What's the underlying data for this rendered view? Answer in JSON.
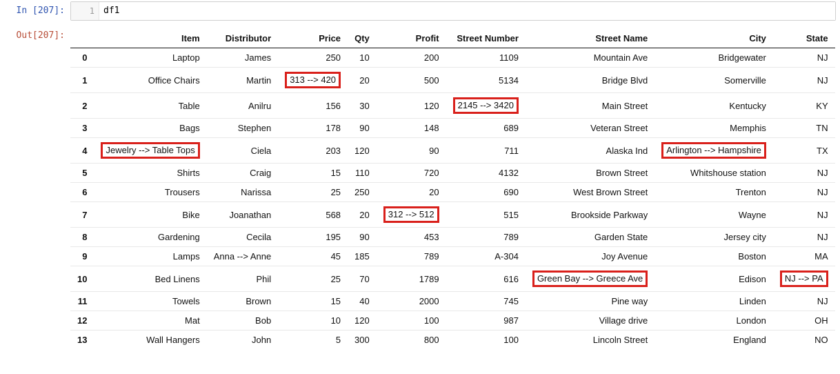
{
  "input": {
    "prompt": "In [207]:",
    "line_number": "1",
    "code": "df1"
  },
  "output": {
    "prompt": "Out[207]:",
    "columns": [
      "Item",
      "Distributor",
      "Price",
      "Qty",
      "Profit",
      "Street Number",
      "Street Name",
      "City",
      "State"
    ],
    "rows": [
      {
        "idx": "0",
        "cells": [
          {
            "v": "Laptop"
          },
          {
            "v": "James"
          },
          {
            "v": "250"
          },
          {
            "v": "10"
          },
          {
            "v": "200"
          },
          {
            "v": "1109"
          },
          {
            "v": "Mountain Ave"
          },
          {
            "v": "Bridgewater"
          },
          {
            "v": "NJ"
          }
        ]
      },
      {
        "idx": "1",
        "cells": [
          {
            "v": "Office Chairs"
          },
          {
            "v": "Martin"
          },
          {
            "v": "313 --> 420",
            "hl": true
          },
          {
            "v": "20"
          },
          {
            "v": "500"
          },
          {
            "v": "5134"
          },
          {
            "v": "Bridge Blvd"
          },
          {
            "v": "Somerville"
          },
          {
            "v": "NJ"
          }
        ]
      },
      {
        "idx": "2",
        "cells": [
          {
            "v": "Table"
          },
          {
            "v": "Anilru"
          },
          {
            "v": "156"
          },
          {
            "v": "30"
          },
          {
            "v": "120"
          },
          {
            "v": "2145 --> 3420",
            "hl": true
          },
          {
            "v": "Main Street"
          },
          {
            "v": "Kentucky"
          },
          {
            "v": "KY"
          }
        ]
      },
      {
        "idx": "3",
        "cells": [
          {
            "v": "Bags"
          },
          {
            "v": "Stephen"
          },
          {
            "v": "178"
          },
          {
            "v": "90"
          },
          {
            "v": "148"
          },
          {
            "v": "689"
          },
          {
            "v": "Veteran Street"
          },
          {
            "v": "Memphis"
          },
          {
            "v": "TN"
          }
        ]
      },
      {
        "idx": "4",
        "cells": [
          {
            "v": "Jewelry --> Table Tops",
            "hl": true
          },
          {
            "v": "Ciela"
          },
          {
            "v": "203"
          },
          {
            "v": "120"
          },
          {
            "v": "90"
          },
          {
            "v": "711"
          },
          {
            "v": "Alaska Ind"
          },
          {
            "v": "Arlington --> Hampshire",
            "hl": true
          },
          {
            "v": "TX"
          }
        ]
      },
      {
        "idx": "5",
        "cells": [
          {
            "v": "Shirts"
          },
          {
            "v": "Craig"
          },
          {
            "v": "15"
          },
          {
            "v": "110"
          },
          {
            "v": "720"
          },
          {
            "v": "4132"
          },
          {
            "v": "Brown Street"
          },
          {
            "v": "Whitshouse station"
          },
          {
            "v": "NJ"
          }
        ]
      },
      {
        "idx": "6",
        "cells": [
          {
            "v": "Trousers"
          },
          {
            "v": "Narissa"
          },
          {
            "v": "25"
          },
          {
            "v": "250"
          },
          {
            "v": "20"
          },
          {
            "v": "690"
          },
          {
            "v": "West Brown Street"
          },
          {
            "v": "Trenton"
          },
          {
            "v": "NJ"
          }
        ]
      },
      {
        "idx": "7",
        "cells": [
          {
            "v": "Bike"
          },
          {
            "v": "Joanathan"
          },
          {
            "v": "568"
          },
          {
            "v": "20"
          },
          {
            "v": "312 --> 512",
            "hl": true
          },
          {
            "v": "515"
          },
          {
            "v": "Brookside Parkway"
          },
          {
            "v": "Wayne"
          },
          {
            "v": "NJ"
          }
        ]
      },
      {
        "idx": "8",
        "cells": [
          {
            "v": "Gardening"
          },
          {
            "v": "Cecila"
          },
          {
            "v": "195"
          },
          {
            "v": "90"
          },
          {
            "v": "453"
          },
          {
            "v": "789"
          },
          {
            "v": "Garden State"
          },
          {
            "v": "Jersey city"
          },
          {
            "v": "NJ"
          }
        ]
      },
      {
        "idx": "9",
        "cells": [
          {
            "v": "Lamps"
          },
          {
            "v": "Anna --> Anne"
          },
          {
            "v": "45"
          },
          {
            "v": "185"
          },
          {
            "v": "789"
          },
          {
            "v": "A-304"
          },
          {
            "v": "Joy Avenue"
          },
          {
            "v": "Boston"
          },
          {
            "v": "MA"
          }
        ]
      },
      {
        "idx": "10",
        "cells": [
          {
            "v": "Bed Linens"
          },
          {
            "v": "Phil"
          },
          {
            "v": "25"
          },
          {
            "v": "70"
          },
          {
            "v": "1789"
          },
          {
            "v": "616"
          },
          {
            "v": "Green Bay --> Greece Ave",
            "hl": true
          },
          {
            "v": "Edison"
          },
          {
            "v": "NJ --> PA",
            "hl": true
          }
        ]
      },
      {
        "idx": "11",
        "cells": [
          {
            "v": "Towels"
          },
          {
            "v": "Brown"
          },
          {
            "v": "15"
          },
          {
            "v": "40"
          },
          {
            "v": "2000"
          },
          {
            "v": "745"
          },
          {
            "v": "Pine way"
          },
          {
            "v": "Linden"
          },
          {
            "v": "NJ"
          }
        ]
      },
      {
        "idx": "12",
        "cells": [
          {
            "v": "Mat"
          },
          {
            "v": "Bob"
          },
          {
            "v": "10"
          },
          {
            "v": "120"
          },
          {
            "v": "100"
          },
          {
            "v": "987"
          },
          {
            "v": "Village drive"
          },
          {
            "v": "London"
          },
          {
            "v": "OH"
          }
        ]
      },
      {
        "idx": "13",
        "cells": [
          {
            "v": "Wall Hangers"
          },
          {
            "v": "John"
          },
          {
            "v": "5"
          },
          {
            "v": "300"
          },
          {
            "v": "800"
          },
          {
            "v": "100"
          },
          {
            "v": "Lincoln Street"
          },
          {
            "v": "England"
          },
          {
            "v": "NO"
          }
        ]
      }
    ]
  }
}
